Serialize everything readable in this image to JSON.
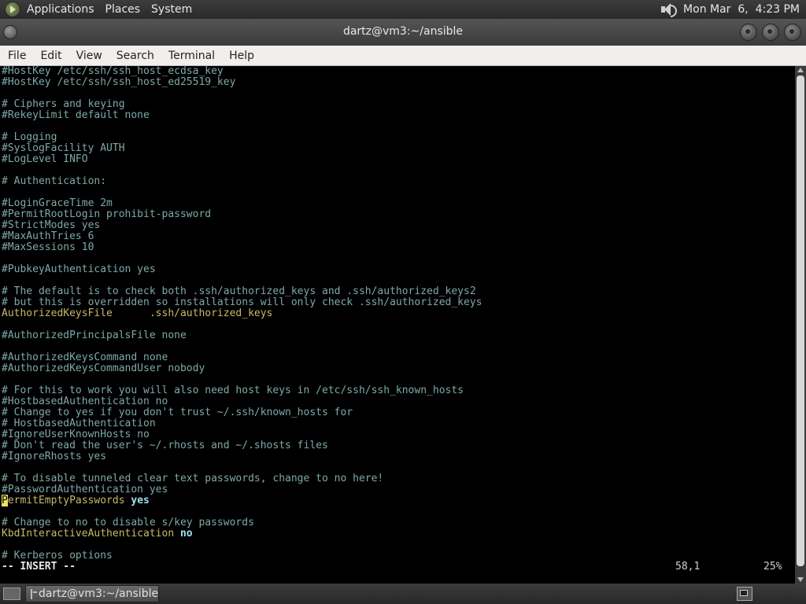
{
  "top_panel": {
    "menus": [
      "Applications",
      "Places",
      "System"
    ],
    "clock": "Mon Mar  6,  4:23 PM"
  },
  "window": {
    "title": "dartz@vm3:~/ansible"
  },
  "menubar": {
    "items": [
      "File",
      "Edit",
      "View",
      "Search",
      "Terminal",
      "Help"
    ]
  },
  "terminal": {
    "lines": [
      {
        "t": "#HostKey /etc/ssh/ssh_host_ecdsa_key",
        "s": "comment"
      },
      {
        "t": "#HostKey /etc/ssh/ssh_host_ed25519_key",
        "s": "comment"
      },
      {
        "t": "",
        "s": "plain"
      },
      {
        "t": "# Ciphers and keying",
        "s": "comment"
      },
      {
        "t": "#RekeyLimit default none",
        "s": "comment"
      },
      {
        "t": "",
        "s": "plain"
      },
      {
        "t": "# Logging",
        "s": "comment"
      },
      {
        "t": "#SyslogFacility AUTH",
        "s": "comment"
      },
      {
        "t": "#LogLevel INFO",
        "s": "comment"
      },
      {
        "t": "",
        "s": "plain"
      },
      {
        "t": "# Authentication:",
        "s": "comment"
      },
      {
        "t": "",
        "s": "plain"
      },
      {
        "t": "#LoginGraceTime 2m",
        "s": "comment"
      },
      {
        "t": "#PermitRootLogin prohibit-password",
        "s": "comment"
      },
      {
        "t": "#StrictModes yes",
        "s": "comment"
      },
      {
        "t": "#MaxAuthTries 6",
        "s": "comment"
      },
      {
        "t": "#MaxSessions 10",
        "s": "comment"
      },
      {
        "t": "",
        "s": "plain"
      },
      {
        "t": "#PubkeyAuthentication yes",
        "s": "comment"
      },
      {
        "t": "",
        "s": "plain"
      },
      {
        "t": "# The default is to check both .ssh/authorized_keys and .ssh/authorized_keys2",
        "s": "comment"
      },
      {
        "t": "# but this is overridden so installations will only check .ssh/authorized_keys",
        "s": "comment"
      },
      {
        "t": "AuthorizedKeysFile      .ssh/authorized_keys",
        "s": "yellow"
      },
      {
        "t": "",
        "s": "plain"
      },
      {
        "t": "#AuthorizedPrincipalsFile none",
        "s": "comment"
      },
      {
        "t": "",
        "s": "plain"
      },
      {
        "t": "#AuthorizedKeysCommand none",
        "s": "comment"
      },
      {
        "t": "#AuthorizedKeysCommandUser nobody",
        "s": "comment"
      },
      {
        "t": "",
        "s": "plain"
      },
      {
        "t": "# For this to work you will also need host keys in /etc/ssh/ssh_known_hosts",
        "s": "comment"
      },
      {
        "t": "#HostbasedAuthentication no",
        "s": "comment"
      },
      {
        "t": "# Change to yes if you don't trust ~/.ssh/known_hosts for",
        "s": "comment"
      },
      {
        "t": "# HostbasedAuthentication",
        "s": "comment"
      },
      {
        "t": "#IgnoreUserKnownHosts no",
        "s": "comment"
      },
      {
        "t": "# Don't read the user's ~/.rhosts and ~/.shosts files",
        "s": "comment"
      },
      {
        "t": "#IgnoreRhosts yes",
        "s": "comment"
      },
      {
        "t": "",
        "s": "plain"
      },
      {
        "t": "# To disable tunneled clear text passwords, change to no here!",
        "s": "comment"
      },
      {
        "t": "#PasswordAuthentication yes",
        "s": "comment"
      },
      {
        "t": "PermitEmptyPasswords",
        "s": "cursor-line",
        "v": "yes"
      },
      {
        "t": "",
        "s": "plain"
      },
      {
        "t": "# Change to no to disable s/key passwords",
        "s": "comment"
      },
      {
        "t": "KbdInteractiveAuthentication",
        "s": "kv",
        "v": "no"
      },
      {
        "t": "",
        "s": "plain"
      },
      {
        "t": "# Kerberos options",
        "s": "comment"
      }
    ],
    "status": {
      "mode": "-- INSERT --",
      "position": "58,1",
      "percent": "25%"
    }
  },
  "taskbar": {
    "window_button": "dartz@vm3:~/ansible"
  },
  "icons": {
    "app_logo": "gnome-foot-icon",
    "volume": "speaker-icon",
    "terminal": "terminal-icon",
    "desktop": "show-desktop-icon",
    "workspace": "workspace-switcher-icon"
  }
}
